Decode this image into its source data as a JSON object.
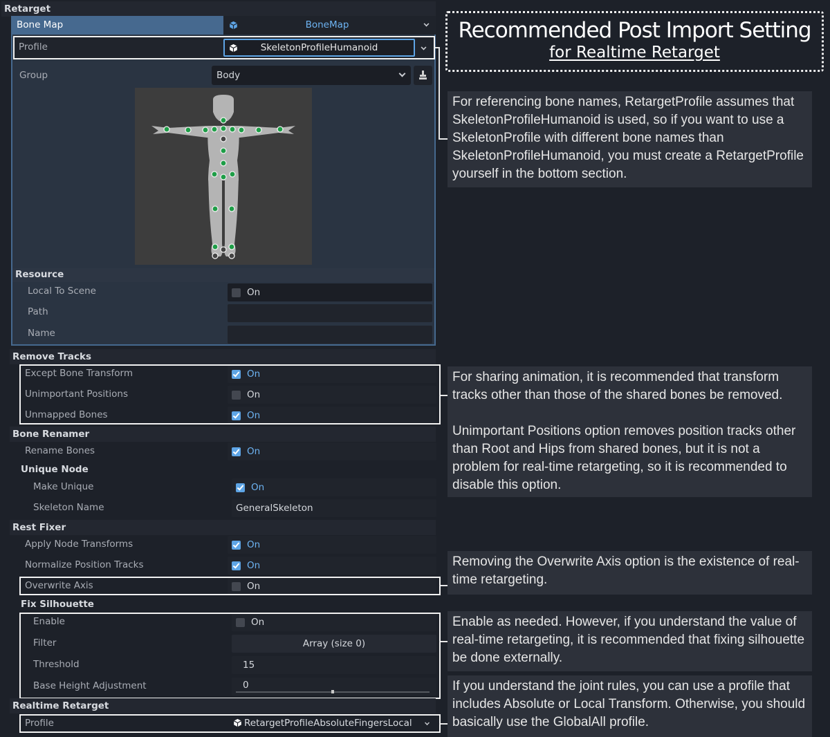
{
  "header": {
    "title_main": "Recommended Post Import Setting",
    "title_sub": "for Realtime Retarget"
  },
  "retarget": {
    "section": "Retarget",
    "bone_map": {
      "label": "Bone Map",
      "value": "BoneMap",
      "icon": "resource-cube-icon"
    },
    "profile": {
      "label": "Profile",
      "value": "SkeletonProfileHumanoid",
      "icon": "resource-cube-icon"
    },
    "group": {
      "label": "Group",
      "value": "Body",
      "icon_button": "clear-brush-icon"
    },
    "skeleton_view": {
      "joints_mapped": 22,
      "joints_unmapped": 4
    },
    "resource": {
      "section": "Resource",
      "local_to_scene": {
        "label": "Local To Scene",
        "checked": false,
        "text": "On"
      },
      "path": {
        "label": "Path",
        "value": ""
      },
      "name": {
        "label": "Name",
        "value": ""
      }
    }
  },
  "remove_tracks": {
    "section": "Remove Tracks",
    "items": [
      {
        "label": "Except Bone Transform",
        "checked": true,
        "text": "On"
      },
      {
        "label": "Unimportant Positions",
        "checked": false,
        "text": "On"
      },
      {
        "label": "Unmapped Bones",
        "checked": true,
        "text": "On"
      }
    ]
  },
  "bone_renamer": {
    "section": "Bone Renamer",
    "rename_bones": {
      "label": "Rename Bones",
      "checked": true,
      "text": "On"
    },
    "unique_node": {
      "section": "Unique Node",
      "make_unique": {
        "label": "Make Unique",
        "checked": true,
        "text": "On"
      },
      "skeleton_name": {
        "label": "Skeleton Name",
        "value": "GeneralSkeleton"
      }
    }
  },
  "rest_fixer": {
    "section": "Rest Fixer",
    "apply_node_transforms": {
      "label": "Apply Node Transforms",
      "checked": true,
      "text": "On"
    },
    "normalize_position_tracks": {
      "label": "Normalize Position Tracks",
      "checked": true,
      "text": "On"
    },
    "overwrite_axis": {
      "label": "Overwrite Axis",
      "checked": false,
      "text": "On"
    },
    "fix_silhouette": {
      "section": "Fix Silhouette",
      "enable": {
        "label": "Enable",
        "checked": false,
        "text": "On"
      },
      "filter": {
        "label": "Filter",
        "value": "Array (size 0)"
      },
      "threshold": {
        "label": "Threshold",
        "value": "15"
      },
      "base_height_adjustment": {
        "label": "Base Height Adjustment",
        "value": "0",
        "slider_fraction": 0.5
      }
    }
  },
  "realtime_retarget": {
    "section": "Realtime Retarget",
    "profile": {
      "label": "Profile",
      "value": "RetargetProfileAbsoluteFingersLocal",
      "icon": "resource-cube-icon"
    }
  },
  "notes": {
    "profile": "For referencing bone names, RetargetProfile assumes that SkeletonProfileHumanoid is used, so if you want to use a SkeletonProfile with different bone names than SkeletonProfileHumanoid, you must create a RetargetProfile yourself in the bottom section.",
    "remove_tracks_1": "For sharing animation, it is recommended that transform tracks other than those of the shared bones be removed.",
    "remove_tracks_2": "Unimportant Positions option removes position tracks other than Root and Hips from shared bones, but it is not a problem for real-time retargeting, so it is recommended to disable this option.",
    "overwrite_axis": "Removing the Overwrite Axis option is the existence of real-time retargeting.",
    "fix_silhouette": "Enable as needed. However, if you understand the value of real-time retargeting, it is recommended that fixing silhouette be done externally.",
    "realtime_profile": "If you understand the joint rules, you can use a profile that includes Absolute or Local Transform. Otherwise, you should basically use the GlobalAll profile."
  },
  "colors": {
    "accent": "#5ea5e6",
    "on_text": "#6db3f2",
    "bone_map_header": "#46698f",
    "sub_resource_bg": "#2a3442",
    "joint_mapped": "#1e9e47"
  }
}
